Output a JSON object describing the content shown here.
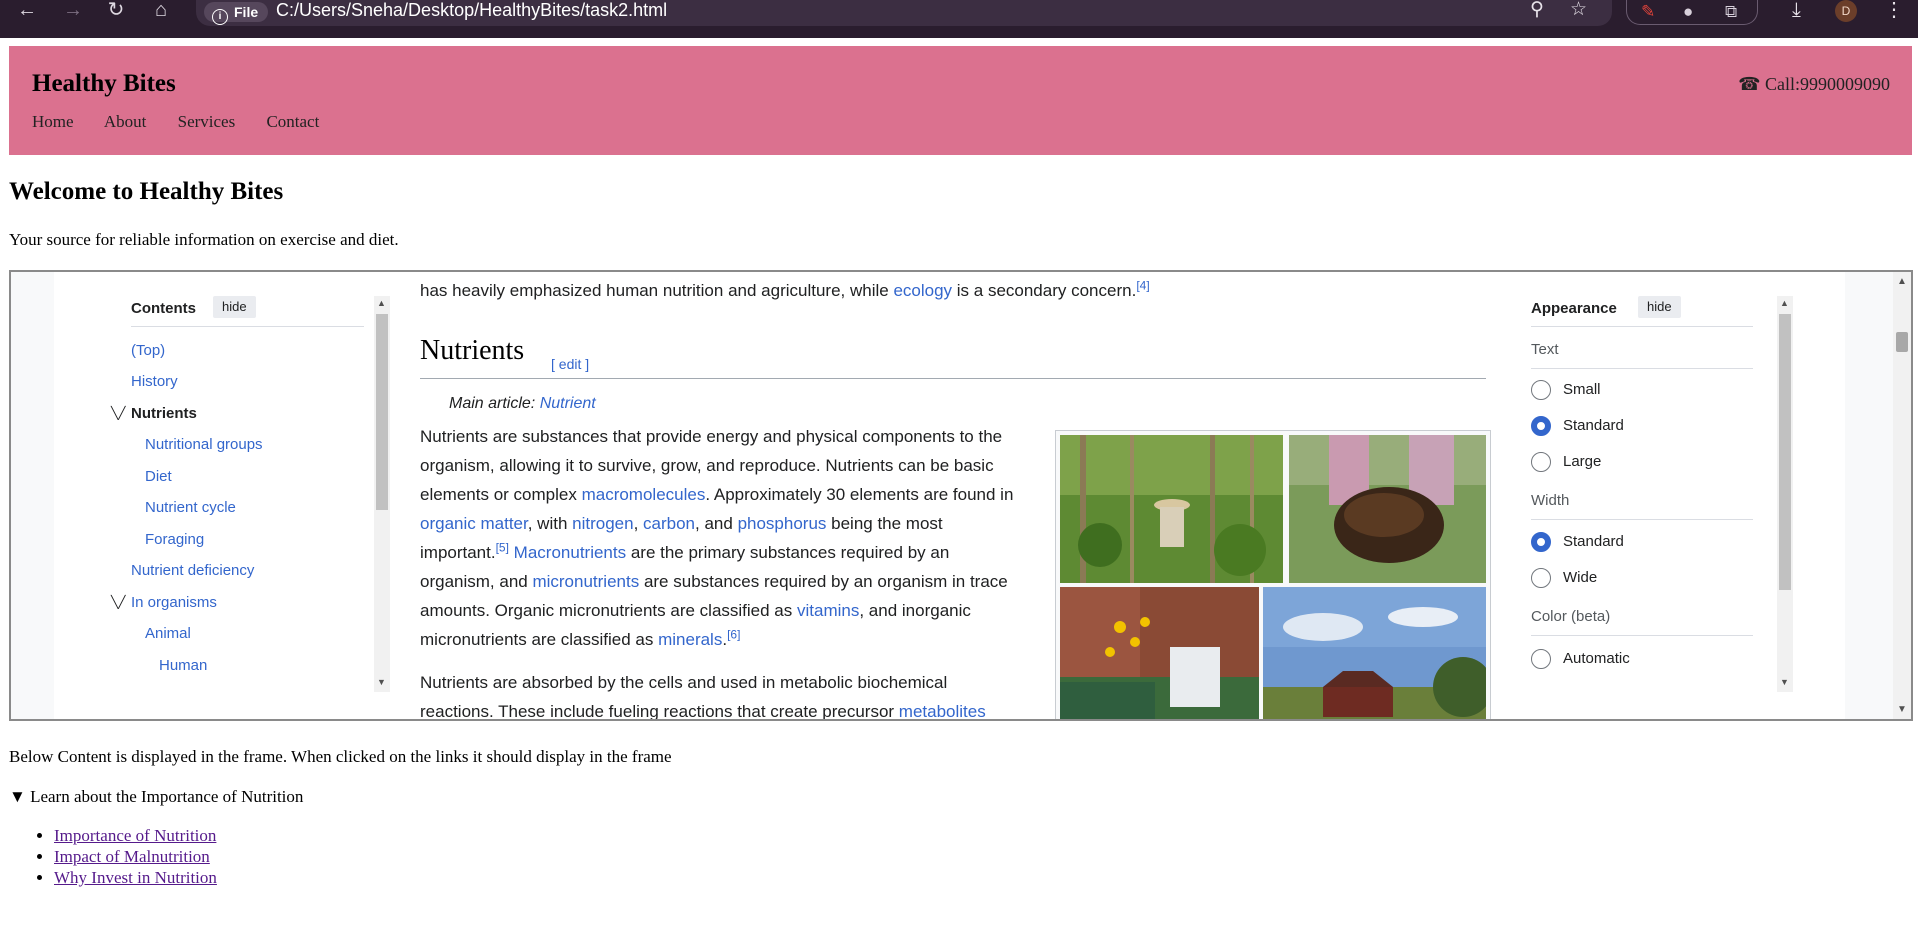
{
  "browser": {
    "url": "C:/Users/Sneha/Desktop/HealthyBites/task2.html",
    "scheme_chip": "File",
    "profile_initial": "D",
    "icons": [
      "back-icon",
      "forward-icon",
      "reload-icon",
      "home-icon",
      "info-icon",
      "zoom-icon",
      "star-icon",
      "pen-extension-icon",
      "extension-icon",
      "puzzle-icon",
      "download-icon",
      "more-icon"
    ]
  },
  "header": {
    "title": "Healthy Bites",
    "nav": [
      "Home",
      "About",
      "Services",
      "Contact"
    ],
    "call": "☎ Call:9990009090",
    "background": "#db718f"
  },
  "main": {
    "heading": "Welcome to Healthy Bites",
    "tagline": "Your source for reliable information on exercise and diet."
  },
  "frame": {
    "toc": {
      "title": "Contents",
      "hide_label": "hide",
      "items": [
        {
          "label": "(Top)"
        },
        {
          "label": "History"
        },
        {
          "label": "Nutrients"
        },
        {
          "label": "Nutritional groups"
        },
        {
          "label": "Diet"
        },
        {
          "label": "Nutrient cycle"
        },
        {
          "label": "Foraging"
        },
        {
          "label": "Nutrient deficiency"
        },
        {
          "label": "In organisms"
        },
        {
          "label": "Animal"
        },
        {
          "label": "Human"
        }
      ]
    },
    "article": {
      "lead_prefix": "has heavily emphasized human nutrition and agriculture, while ",
      "lead_link": "ecology",
      "lead_suffix": " is a secondary concern.",
      "lead_ref": "[4]",
      "section_title": "Nutrients",
      "edit_label": "[ edit ]",
      "hatnote_prefix": "Main article: ",
      "hatnote_link": "Nutrient",
      "p1": {
        "t1": "Nutrients are substances that provide energy and physical components to the organism, allowing it to survive, grow, and reproduce. Nutrients can be basic elements or complex ",
        "l1": "macromolecules",
        "t2": ". Approximately 30 elements are found in ",
        "l2": "organic matter",
        "t3": ", with ",
        "l3": "nitrogen",
        "t4": ", ",
        "l4": "carbon",
        "t5": ", and ",
        "l5": "phosphorus",
        "t6": " being the most important.",
        "r1": "[5]",
        "t7": " ",
        "l6": "Macronutrients",
        "t8": " are the primary substances required by an organism, and ",
        "l7": "micronutrients",
        "t9": " are substances required by an organism in trace amounts. Organic micronutrients are classified as ",
        "l8": "vitamins",
        "t10": ", and inorganic micronutrients are classified as ",
        "l9": "minerals",
        "t11": ".",
        "r2": "[6]"
      },
      "p2": {
        "t1": "Nutrients are absorbed by the cells and used in metabolic biochemical reactions. These include fueling reactions that create precursor ",
        "l1": "metabolites"
      }
    },
    "appearance": {
      "title": "Appearance",
      "hide_label": "hide",
      "text_label": "Text",
      "text_options": [
        "Small",
        "Standard",
        "Large"
      ],
      "text_selected": "Standard",
      "width_label": "Width",
      "width_options": [
        "Standard",
        "Wide"
      ],
      "width_selected": "Standard",
      "color_label": "Color (beta)",
      "color_options": [
        "Automatic"
      ]
    }
  },
  "below": {
    "note": "Below Content is displayed in the frame. When clicked on the links it should display in the frame",
    "details_summary": "▼ Learn about the Importance of Nutrition",
    "links": [
      "Importance of Nutrition",
      "Impact of Malnutrition",
      "Why Invest in Nutrition"
    ]
  }
}
